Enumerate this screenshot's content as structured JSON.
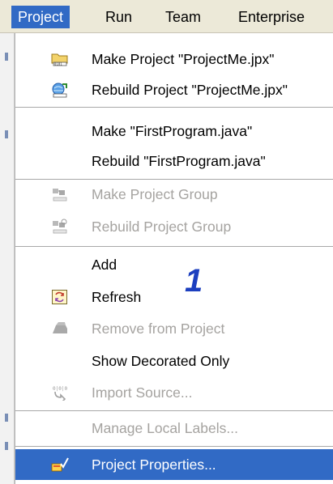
{
  "menubar": {
    "items": [
      {
        "label": "Project",
        "active": true
      },
      {
        "label": "Run"
      },
      {
        "label": "Team"
      },
      {
        "label": "Enterprise"
      }
    ]
  },
  "menu": {
    "make_project": "Make Project \"ProjectMe.jpx\"",
    "rebuild_project": "Rebuild Project \"ProjectMe.jpx\"",
    "make_file": "Make \"FirstProgram.java\"",
    "rebuild_file": "Rebuild \"FirstProgram.java\"",
    "make_group": "Make Project Group",
    "rebuild_group": "Rebuild Project Group",
    "add": "Add",
    "refresh": "Refresh",
    "remove": "Remove from Project",
    "show_decorated": "Show Decorated Only",
    "import_source": "Import Source...",
    "manage_labels": "Manage Local Labels...",
    "project_properties": "Project Properties..."
  },
  "annotation": "1",
  "colors": {
    "menubar_bg": "#ece9d8",
    "highlight": "#316ac5",
    "disabled_text": "#a5a3a0",
    "annotation": "#1c3fbf"
  },
  "icons": {
    "make_project": "folder-binary-icon",
    "rebuild_project": "globe-arrow-icon",
    "make_group": "group-make-icon",
    "rebuild_group": "group-rebuild-icon",
    "refresh": "refresh-icon",
    "remove": "remove-icon",
    "import": "import-source-icon",
    "properties": "project-properties-icon"
  }
}
